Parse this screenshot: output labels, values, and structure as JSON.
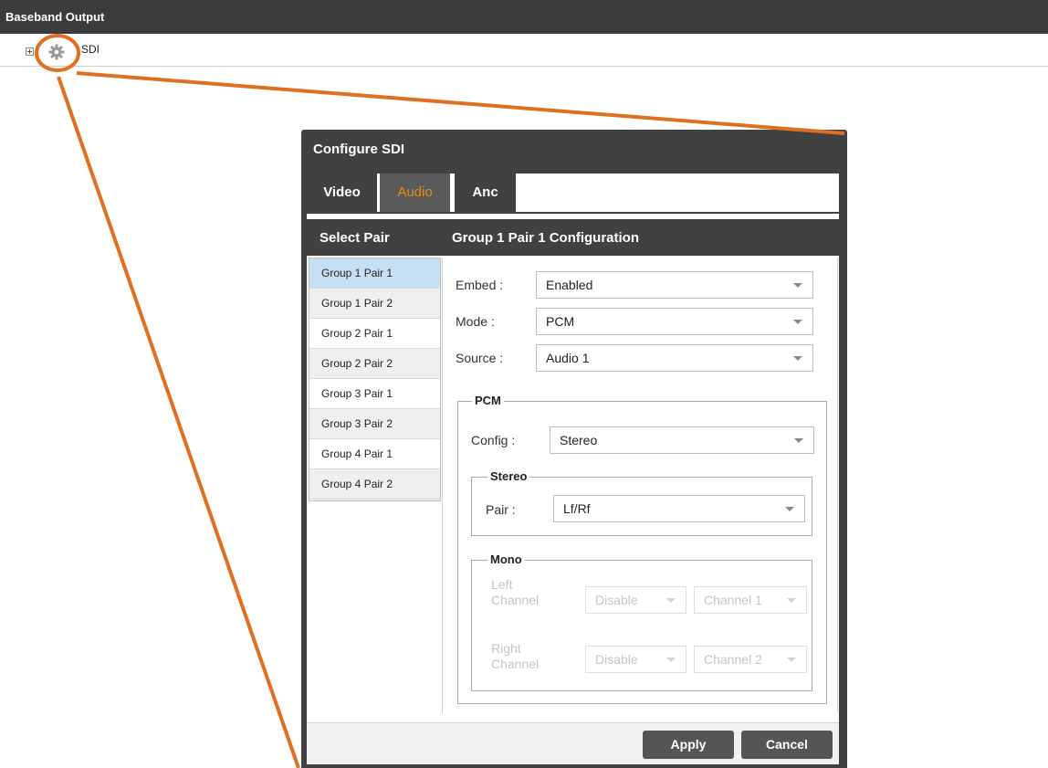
{
  "app": {
    "header_title": "Baseband Output"
  },
  "tree": {
    "node_label": "SDI",
    "icons": [
      "expand-icon",
      "gear-icon"
    ]
  },
  "dialog": {
    "title": "Configure SDI",
    "tabs": [
      {
        "label": "Video",
        "active": false
      },
      {
        "label": "Audio",
        "active": true
      },
      {
        "label": "Anc",
        "active": false
      }
    ],
    "select_pair_heading": "Select Pair",
    "config_heading": "Group 1 Pair 1 Configuration",
    "pairs": [
      "Group 1 Pair 1",
      "Group 1 Pair 2",
      "Group 2 Pair 1",
      "Group 2 Pair 2",
      "Group 3 Pair 1",
      "Group 3 Pair 2",
      "Group 4 Pair 1",
      "Group 4 Pair 2"
    ],
    "selected_pair": "Group 1 Pair 1",
    "fields": {
      "embed": {
        "label": "Embed :",
        "value": "Enabled"
      },
      "mode": {
        "label": "Mode :",
        "value": "PCM"
      },
      "source": {
        "label": "Source :",
        "value": "Audio 1"
      }
    },
    "pcm": {
      "legend": "PCM",
      "config": {
        "label": "Config :",
        "value": "Stereo"
      },
      "stereo": {
        "legend": "Stereo",
        "pair": {
          "label": "Pair :",
          "value": "Lf/Rf"
        }
      },
      "mono": {
        "legend": "Mono",
        "left": {
          "label_line1": "Left",
          "label_line2": "Channel",
          "enable": "Disable",
          "channel": "Channel 1"
        },
        "right": {
          "label_line1": "Right",
          "label_line2": "Channel",
          "enable": "Disable",
          "channel": "Channel 2"
        }
      }
    },
    "buttons": {
      "apply": "Apply",
      "cancel": "Cancel"
    }
  },
  "colors": {
    "header_bg": "#3b3b3b",
    "dialog_bg": "#414141",
    "active_tab_text": "#e88a1a",
    "selected_row": "#c6dff3",
    "annotation": "#e07020"
  }
}
